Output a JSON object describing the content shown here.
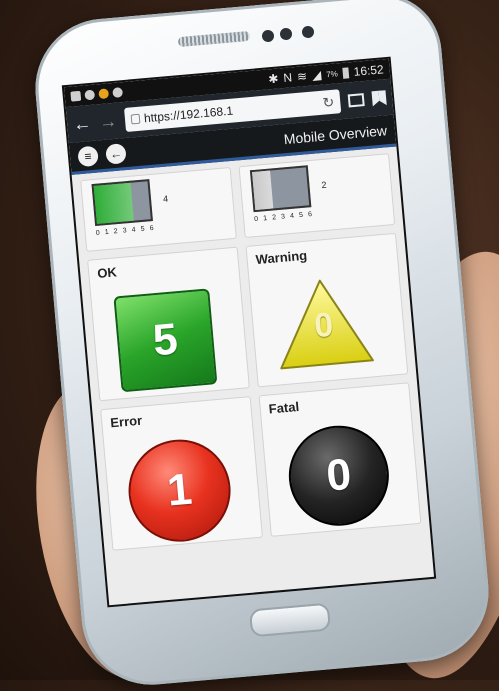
{
  "status_bar": {
    "time": "16:52",
    "battery_percent": "7%"
  },
  "browser": {
    "url": "https://192.168.1"
  },
  "app": {
    "title": "Mobile Overview"
  },
  "gauges": [
    {
      "value": "4",
      "level": 0.68,
      "fill_color": "#2fae38",
      "scale": [
        "0",
        "1",
        "2",
        "3",
        "4",
        "5",
        "6"
      ]
    },
    {
      "value": "2",
      "level": 0.34,
      "fill_color": "#c8c8c8",
      "scale": [
        "0",
        "1",
        "2",
        "3",
        "4",
        "5",
        "6"
      ]
    }
  ],
  "statuses": [
    {
      "label": "OK",
      "value": "5",
      "color": "#2aa52a",
      "shape": "square"
    },
    {
      "label": "Warning",
      "value": "0",
      "color": "#f2ea36",
      "shape": "triangle"
    },
    {
      "label": "Error",
      "value": "1",
      "color": "#e8321f",
      "shape": "circle"
    },
    {
      "label": "Fatal",
      "value": "0",
      "color": "#1a1a1a",
      "shape": "circle"
    }
  ]
}
